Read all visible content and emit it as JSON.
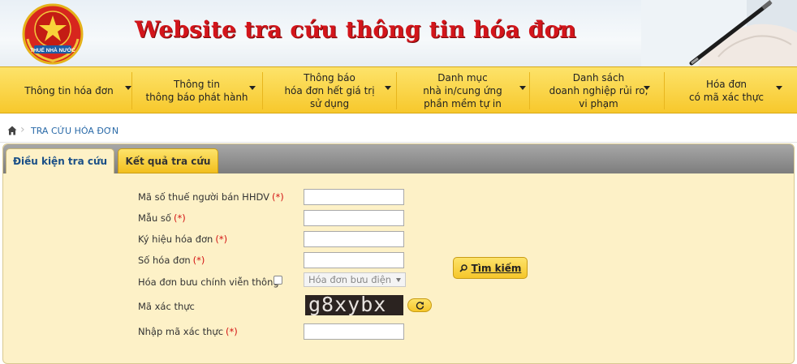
{
  "header": {
    "title": "Website tra cứu thông tin hóa đơn",
    "logo_text": "THUẾ NHÀ NƯỚC"
  },
  "nav": {
    "items": [
      {
        "label": "Thông tin hóa đơn"
      },
      {
        "label": "Thông tin\nthông báo phát hành"
      },
      {
        "label": "Thông báo\nhóa đơn hết giá trị\nsử dụng"
      },
      {
        "label": "Danh mục\nnhà in/cung ứng\nphần mềm tự in"
      },
      {
        "label": "Danh sách\ndoanh nghiệp rủi ro,\nvi phạm"
      },
      {
        "label": "Hóa đơn\ncó mã xác thực"
      }
    ]
  },
  "breadcrumb": {
    "current": "TRA CỨU HÓA ĐƠN"
  },
  "tabs": {
    "conditions": "Điều kiện tra cứu",
    "results": "Kết quả tra cứu"
  },
  "form": {
    "required_marker": "(*)",
    "seller_tax_code_label": "Mã số thuế người bán HHDV",
    "template_label": "Mẫu số",
    "symbol_label": "Ký hiệu hóa đơn",
    "invoice_number_label": "Số hóa đơn",
    "postal_invoice_label": "Hóa đơn bưu chính viễn thông",
    "postal_select_value": "Hóa đơn bưu điện",
    "captcha_label": "Mã xác thực",
    "captcha_text": "g8xybx",
    "captcha_input_label": "Nhập mã xác thực"
  },
  "buttons": {
    "search_label": "Tìm kiếm"
  },
  "colors": {
    "nav_yellow": "#f7c82c",
    "panel_bg": "#fdf1c7",
    "title_red": "#d3151b",
    "required_red": "#d31313",
    "tab_active_text": "#1a4f87"
  }
}
